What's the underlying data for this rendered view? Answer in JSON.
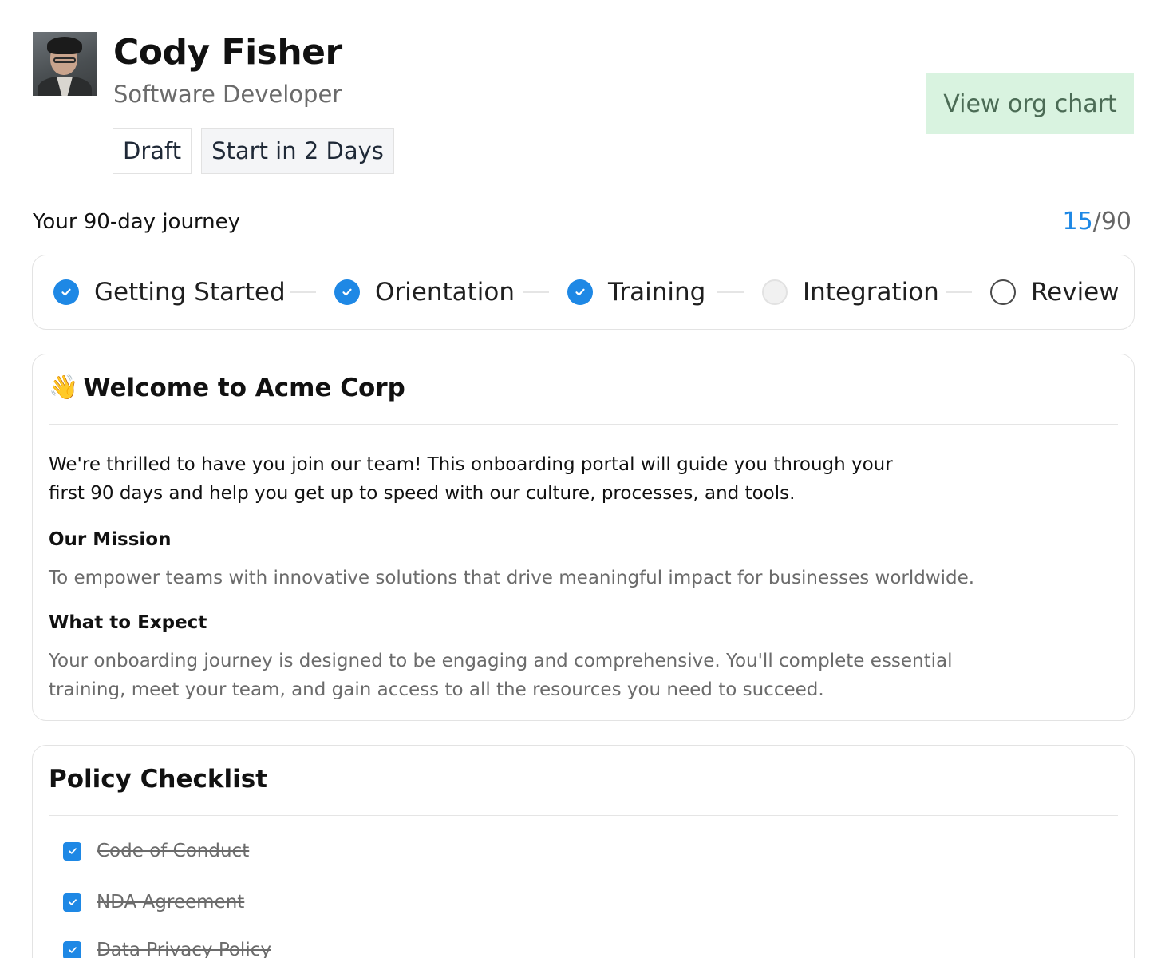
{
  "profile": {
    "name": "Cody Fisher",
    "role": "Software Developer",
    "badges": [
      "Draft",
      "Start in 2 Days"
    ]
  },
  "actions": {
    "org_chart_label": "View org chart"
  },
  "journey": {
    "label": "Your 90-day journey",
    "current": "15",
    "separator": "/",
    "total": "90",
    "steps": [
      {
        "label": "Getting Started",
        "status": "done"
      },
      {
        "label": "Orientation",
        "status": "done"
      },
      {
        "label": "Training",
        "status": "done"
      },
      {
        "label": "Integration",
        "status": "current"
      },
      {
        "label": "Review",
        "status": "todo"
      }
    ]
  },
  "welcome": {
    "icon": "waving-hand-icon",
    "title": "Welcome to Acme Corp",
    "intro": "We're thrilled to have you join our team! This onboarding portal will guide you through your first 90 days and help you get up to speed with our culture, processes, and tools.",
    "mission_heading": "Our Mission",
    "mission_text": "To empower teams with innovative solutions that drive meaningful impact for businesses worldwide.",
    "expect_heading": "What to Expect",
    "expect_text": "Your onboarding journey is designed to be engaging and comprehensive. You'll complete essential training, meet your team, and gain access to all the resources you need to succeed."
  },
  "policy": {
    "title": "Policy Checklist",
    "items": [
      {
        "label": "Code of Conduct",
        "checked": true
      },
      {
        "label": "NDA Agreement",
        "checked": true
      },
      {
        "label": "Data Privacy Policy",
        "checked": true
      }
    ]
  },
  "colors": {
    "accent": "#1e88e5",
    "org_button_bg": "#d9f3e0",
    "org_button_text": "#4b6b55"
  }
}
